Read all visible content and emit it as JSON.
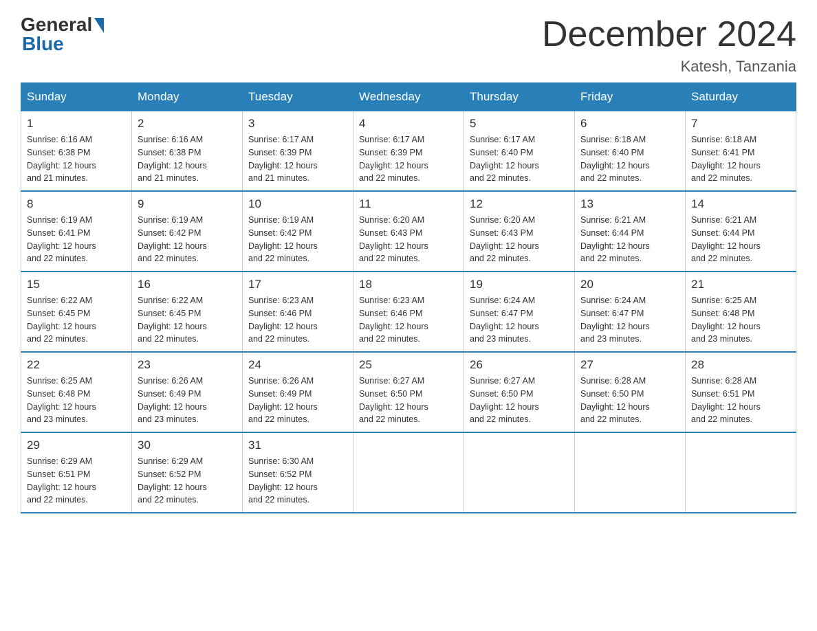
{
  "header": {
    "logo_general": "General",
    "logo_blue": "Blue",
    "month_title": "December 2024",
    "location": "Katesh, Tanzania"
  },
  "weekdays": [
    "Sunday",
    "Monday",
    "Tuesday",
    "Wednesday",
    "Thursday",
    "Friday",
    "Saturday"
  ],
  "weeks": [
    [
      {
        "day": "1",
        "sunrise": "6:16 AM",
        "sunset": "6:38 PM",
        "daylight": "12 hours and 21 minutes."
      },
      {
        "day": "2",
        "sunrise": "6:16 AM",
        "sunset": "6:38 PM",
        "daylight": "12 hours and 21 minutes."
      },
      {
        "day": "3",
        "sunrise": "6:17 AM",
        "sunset": "6:39 PM",
        "daylight": "12 hours and 21 minutes."
      },
      {
        "day": "4",
        "sunrise": "6:17 AM",
        "sunset": "6:39 PM",
        "daylight": "12 hours and 22 minutes."
      },
      {
        "day": "5",
        "sunrise": "6:17 AM",
        "sunset": "6:40 PM",
        "daylight": "12 hours and 22 minutes."
      },
      {
        "day": "6",
        "sunrise": "6:18 AM",
        "sunset": "6:40 PM",
        "daylight": "12 hours and 22 minutes."
      },
      {
        "day": "7",
        "sunrise": "6:18 AM",
        "sunset": "6:41 PM",
        "daylight": "12 hours and 22 minutes."
      }
    ],
    [
      {
        "day": "8",
        "sunrise": "6:19 AM",
        "sunset": "6:41 PM",
        "daylight": "12 hours and 22 minutes."
      },
      {
        "day": "9",
        "sunrise": "6:19 AM",
        "sunset": "6:42 PM",
        "daylight": "12 hours and 22 minutes."
      },
      {
        "day": "10",
        "sunrise": "6:19 AM",
        "sunset": "6:42 PM",
        "daylight": "12 hours and 22 minutes."
      },
      {
        "day": "11",
        "sunrise": "6:20 AM",
        "sunset": "6:43 PM",
        "daylight": "12 hours and 22 minutes."
      },
      {
        "day": "12",
        "sunrise": "6:20 AM",
        "sunset": "6:43 PM",
        "daylight": "12 hours and 22 minutes."
      },
      {
        "day": "13",
        "sunrise": "6:21 AM",
        "sunset": "6:44 PM",
        "daylight": "12 hours and 22 minutes."
      },
      {
        "day": "14",
        "sunrise": "6:21 AM",
        "sunset": "6:44 PM",
        "daylight": "12 hours and 22 minutes."
      }
    ],
    [
      {
        "day": "15",
        "sunrise": "6:22 AM",
        "sunset": "6:45 PM",
        "daylight": "12 hours and 22 minutes."
      },
      {
        "day": "16",
        "sunrise": "6:22 AM",
        "sunset": "6:45 PM",
        "daylight": "12 hours and 22 minutes."
      },
      {
        "day": "17",
        "sunrise": "6:23 AM",
        "sunset": "6:46 PM",
        "daylight": "12 hours and 22 minutes."
      },
      {
        "day": "18",
        "sunrise": "6:23 AM",
        "sunset": "6:46 PM",
        "daylight": "12 hours and 22 minutes."
      },
      {
        "day": "19",
        "sunrise": "6:24 AM",
        "sunset": "6:47 PM",
        "daylight": "12 hours and 23 minutes."
      },
      {
        "day": "20",
        "sunrise": "6:24 AM",
        "sunset": "6:47 PM",
        "daylight": "12 hours and 23 minutes."
      },
      {
        "day": "21",
        "sunrise": "6:25 AM",
        "sunset": "6:48 PM",
        "daylight": "12 hours and 23 minutes."
      }
    ],
    [
      {
        "day": "22",
        "sunrise": "6:25 AM",
        "sunset": "6:48 PM",
        "daylight": "12 hours and 23 minutes."
      },
      {
        "day": "23",
        "sunrise": "6:26 AM",
        "sunset": "6:49 PM",
        "daylight": "12 hours and 23 minutes."
      },
      {
        "day": "24",
        "sunrise": "6:26 AM",
        "sunset": "6:49 PM",
        "daylight": "12 hours and 22 minutes."
      },
      {
        "day": "25",
        "sunrise": "6:27 AM",
        "sunset": "6:50 PM",
        "daylight": "12 hours and 22 minutes."
      },
      {
        "day": "26",
        "sunrise": "6:27 AM",
        "sunset": "6:50 PM",
        "daylight": "12 hours and 22 minutes."
      },
      {
        "day": "27",
        "sunrise": "6:28 AM",
        "sunset": "6:50 PM",
        "daylight": "12 hours and 22 minutes."
      },
      {
        "day": "28",
        "sunrise": "6:28 AM",
        "sunset": "6:51 PM",
        "daylight": "12 hours and 22 minutes."
      }
    ],
    [
      {
        "day": "29",
        "sunrise": "6:29 AM",
        "sunset": "6:51 PM",
        "daylight": "12 hours and 22 minutes."
      },
      {
        "day": "30",
        "sunrise": "6:29 AM",
        "sunset": "6:52 PM",
        "daylight": "12 hours and 22 minutes."
      },
      {
        "day": "31",
        "sunrise": "6:30 AM",
        "sunset": "6:52 PM",
        "daylight": "12 hours and 22 minutes."
      },
      null,
      null,
      null,
      null
    ]
  ],
  "labels": {
    "sunrise": "Sunrise:",
    "sunset": "Sunset:",
    "daylight": "Daylight:"
  }
}
